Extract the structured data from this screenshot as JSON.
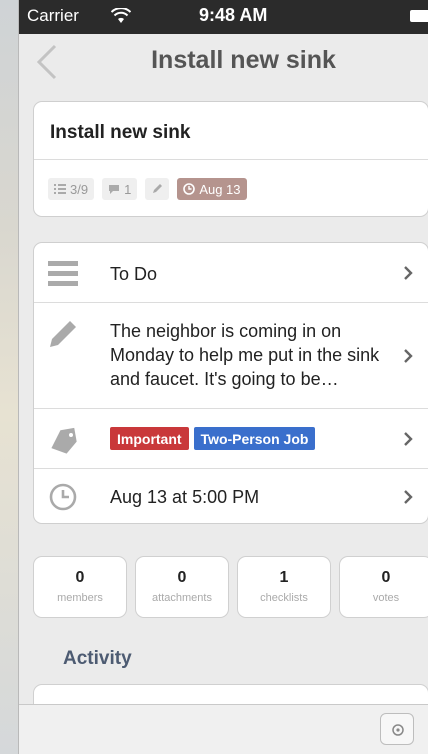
{
  "status_bar": {
    "carrier": "Carrier",
    "time": "9:48 AM"
  },
  "nav": {
    "title": "Install new sink"
  },
  "card": {
    "name": "Install new sink",
    "badges": {
      "checklist": "3/9",
      "comments": "1",
      "due": "Aug 13"
    }
  },
  "details": {
    "list": "To Do",
    "description": "The neighbor is coming in on Monday to help me put in the sink and faucet. It's going to be…",
    "labels": [
      {
        "text": "Important",
        "color": "#c9383a"
      },
      {
        "text": "Two-Person Job",
        "color": "#3a6fcc"
      }
    ],
    "due": "Aug 13 at 5:00 PM"
  },
  "counters": [
    {
      "num": "0",
      "label": "members"
    },
    {
      "num": "0",
      "label": "attachments"
    },
    {
      "num": "1",
      "label": "checklists"
    },
    {
      "num": "0",
      "label": "votes"
    }
  ],
  "activity": {
    "heading": "Activity"
  },
  "colors": {
    "accent_heading": "#4d5b72",
    "due_badge": "#b5948e"
  }
}
